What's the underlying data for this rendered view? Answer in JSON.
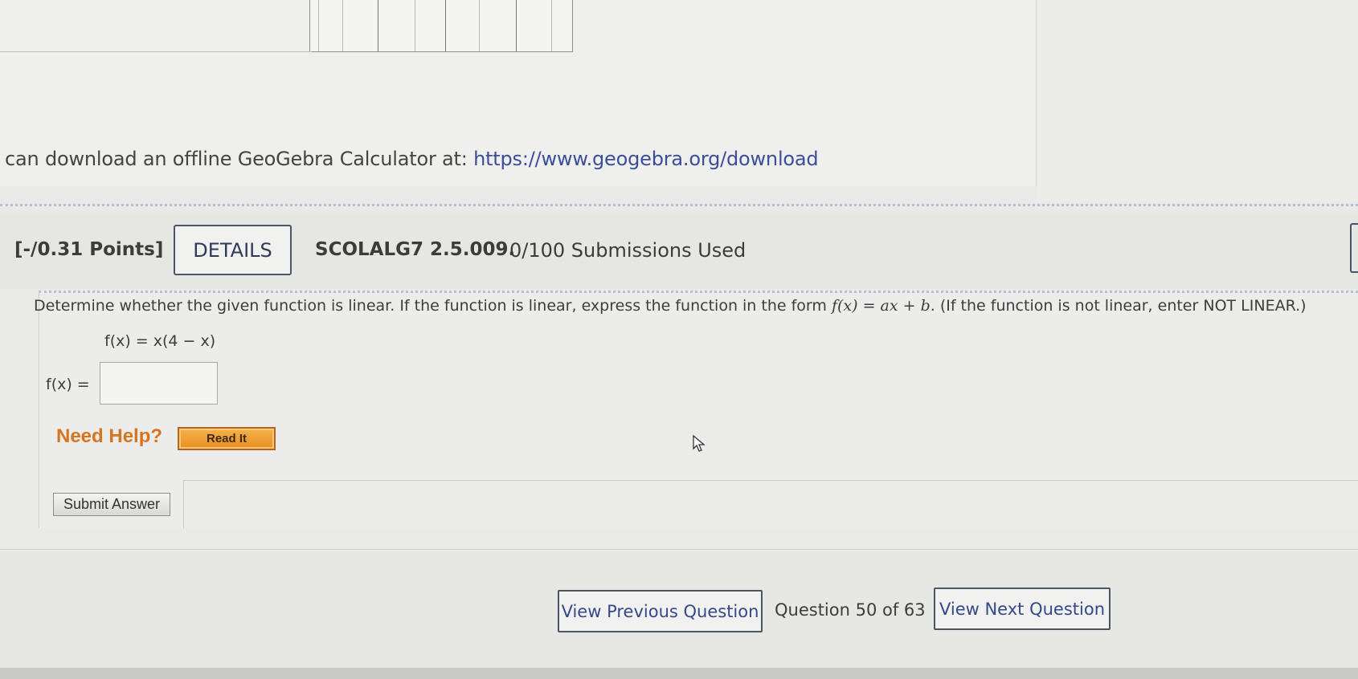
{
  "geogebra": {
    "prefix": "can download an offline GeoGebra Calculator at: ",
    "link": "https://www.geogebra.org/download"
  },
  "question": {
    "points": "[-/0.31 Points]",
    "details_label": "DETAILS",
    "code": "SCOLALG7 2.5.009.",
    "submissions": "0/100 Submissions Used",
    "prompt_start": "Determine whether the given function is linear. If the function is linear, express the function in the form ",
    "prompt_form": "f(x) = ax + b",
    "prompt_end": ".  (If the function is not linear, enter NOT LINEAR.)",
    "given_function": "f(x) = x(4 − x)",
    "answer_label": "f(x) =",
    "answer_value": ""
  },
  "help": {
    "need_help": "Need Help?",
    "read_it": "Read It"
  },
  "submit_label": "Submit Answer",
  "nav": {
    "prev": "View Previous Question",
    "position": "Question 50 of 63",
    "next": "View Next Question"
  },
  "colors": {
    "link": "#3a4e9a",
    "need_help": "#d7741f",
    "read_it_bg": "#f0a13a"
  }
}
